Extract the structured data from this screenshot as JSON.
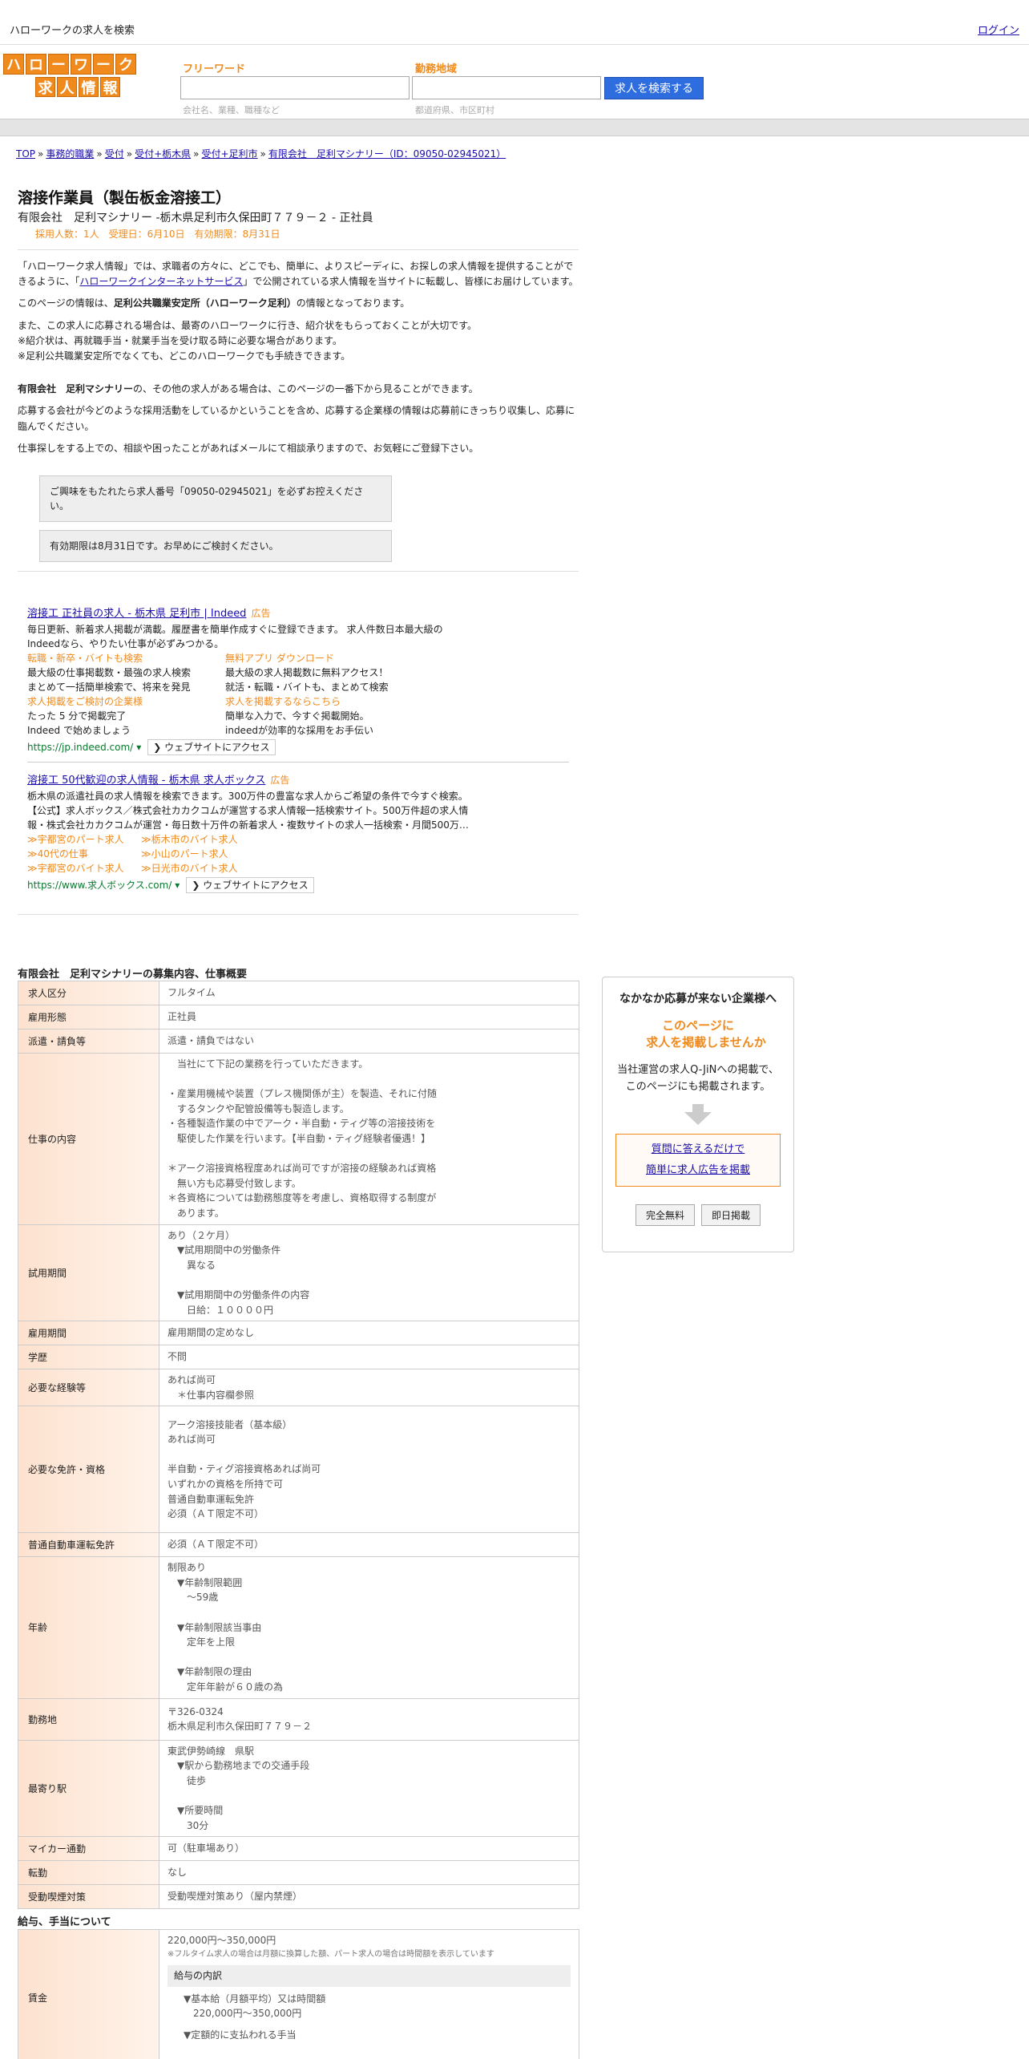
{
  "topbar": {
    "site_title": "ハローワークの求人を検索",
    "login": "ログイン"
  },
  "logo": {
    "row1": [
      "ハ",
      "ロ",
      "ー",
      "ワ",
      "ー",
      "ク"
    ],
    "row2": [
      "求",
      "人",
      "情",
      "報"
    ]
  },
  "search": {
    "freeword_label": "フリーワード",
    "freeword_hint": "会社名、業種、職種など",
    "area_label": "勤務地域",
    "area_hint": "都道府県、市区町村",
    "button": "求人を検索する"
  },
  "breadcrumb": [
    "TOP",
    "事務的職業",
    "受付",
    "受付+栃木県",
    "受付+足利市",
    "有限会社　足利マシナリー（ID：09050-02945021）"
  ],
  "job": {
    "title": "溶接作業員（製缶板金溶接工）",
    "company_line": "有限会社　足利マシナリー -栃木県足利市久保田町７７９－２ - 正社員",
    "meta": "採用人数：1人　受理日：6月10日　有効期限：8月31日"
  },
  "intro": {
    "p1_a": "「ハローワーク求人情報」では、求職者の方々に、どこでも、簡単に、よりスピーディに、お探しの求人情報を提供することができるように、「",
    "p1_link": "ハローワークインターネットサービス",
    "p1_b": "」で公開されている求人情報を当サイトに転載し、皆様にお届けしています。",
    "p2_a": "このページの情報は、",
    "p2_b": "足利公共職業安定所（ハローワーク足利）",
    "p2_c": "の情報となっております。",
    "p3_1": "また、この求人に応募される場合は、最寄のハローワークに行き、紹介状をもらっておくことが大切です。",
    "p3_2": "※紹介状は、再就職手当・就業手当を受け取る時に必要な場合があります。",
    "p3_3": "※足利公共職業安定所でなくても、どこのハローワークでも手続きできます。",
    "p4_a": "有限会社　足利マシナリー",
    "p4_b": "の、その他の求人がある場合は、このページの一番下から見ることができます。",
    "p5": "応募する会社が今どのような採用活動をしているかということを含め、応募する企業様の情報は応募前にきっちり収集し、応募に臨んでください。",
    "p6": "仕事探しをする上での、相談や困ったことがあればメールにて相談承りますので、お気軽にご登録下さい。"
  },
  "notices": [
    "ご興味をもたれたら求人番号「09050-02945021」を必ずお控えください。",
    "有効期限は8月31日です。お早めにご検討ください。"
  ],
  "ad1": {
    "title": "溶接工 正社員の求人 - 栃木県 足利市 | Indeed",
    "tag": "広告",
    "desc1": "毎日更新、新着求人掲載が満載。履歴書を簡単作成すぐに登録できます。 求人件数日本最大級の",
    "desc2": "Indeedなら、やりたい仕事が必ずみつかる。",
    "sitelinks": [
      {
        "title": "転職・新卒・バイトも検索",
        "d1": "最大級の仕事掲載数・最強の求人検索",
        "d2": "まとめて一括簡単検索で、将来を発見"
      },
      {
        "title": "無料アプリ ダウンロード",
        "d1": "最大級の求人掲載数に無料アクセス！",
        "d2": "就活・転職・バイトも、まとめて検索"
      },
      {
        "title": "求人掲載をご検討の企業様",
        "d1": "たった 5 分で掲載完了",
        "d2": "Indeed で始めましょう"
      },
      {
        "title": "求人を掲載するならこちら",
        "d1": "簡単な入力で、今すぐ掲載開始。",
        "d2": "indeedが効率的な採用をお手伝い"
      }
    ],
    "url": "https://jp.indeed.com/",
    "visit": "ウェブサイトにアクセス"
  },
  "ad2": {
    "title": "溶接工 50代歓迎の求人情報 - 栃木県 求人ボックス",
    "tag": "広告",
    "desc1": "栃木県の派遣社員の求人情報を検索できます。300万件の豊富な求人からご希望の条件で今すぐ検索。",
    "desc2": "【公式】求人ボックス／株式会社カカクコムが運営する求人情報一括検索サイト。500万件超の求人情",
    "desc3": "報・株式会社カカクコムが運営・毎日数十万件の新着求人・複数サイトの求人一括検索・月間500万…",
    "links": [
      "≫宇都宮のパート求人",
      "≫栃木市のバイト求人",
      "≫40代の仕事",
      "≫小山のパート求人",
      "≫宇都宮のバイト求人",
      "≫日光市のバイト求人"
    ],
    "url": "https://www.求人ボックス.com/",
    "visit": "ウェブサイトにアクセス"
  },
  "details": {
    "section_title": "有限会社　足利マシナリーの募集内容、仕事概要",
    "rows": [
      {
        "label": "求人区分",
        "value": "フルタイム"
      },
      {
        "label": "雇用形態",
        "value": "正社員"
      },
      {
        "label": "派遣・請負等",
        "value": "派遣・請負ではない"
      },
      {
        "label": "仕事の内容",
        "value": "　当社にて下記の業務を行っていただきます。\n\n・産業用機械や装置（プレス機関係が主）を製造、それに付随\n　するタンクや配管設備等も製造します。\n・各種製造作業の中でアーク・半自動・ティグ等の溶接技術を\n　駆使した作業を行います。【半自動・ティグ経験者優遇！】\n\n＊アーク溶接資格程度あれば尚可ですが溶接の経験あれば資格\n　無い方も応募受付致します。\n＊各資格については勤務態度等を考慮し、資格取得する制度が\n　あります。"
      },
      {
        "label": "試用期間",
        "value": "あり（２ケ月）\n　▼試用期間中の労働条件\n　　異なる\n\n　▼試用期間中の労働条件の内容\n　　日給：１００００円"
      },
      {
        "label": "雇用期間",
        "value": "雇用期間の定めなし"
      },
      {
        "label": "学歴",
        "value": "不問"
      },
      {
        "label": "必要な経験等",
        "value": "あれば尚可\n　＊仕事内容欄参照"
      },
      {
        "label": "必要な免許・資格",
        "value": "アーク溶接技能者（基本級）\nあれば尚可\n\n半自動・ティグ溶接資格あれば尚可\nいずれかの資格を所持で可\n普通自動車運転免許\n必須（ＡＴ限定不可）"
      },
      {
        "label": "普通自動車運転免許",
        "value": "必須（ＡＴ限定不可）"
      },
      {
        "label": "年齢",
        "value": "制限あり\n　▼年齢制限範囲\n　　〜59歳\n\n　▼年齢制限該当事由\n　　定年を上限\n\n　▼年齢制限の理由\n　　定年年齢が６０歳の為"
      },
      {
        "label": "勤務地",
        "value": "〒326-0324\n栃木県足利市久保田町７７９－２"
      },
      {
        "label": "最寄り駅",
        "value": "東武伊勢崎線　県駅\n　▼駅から勤務地までの交通手段\n　　徒歩\n\n　▼所要時間\n　　30分"
      },
      {
        "label": "マイカー通勤",
        "value": "可（駐車場あり）"
      },
      {
        "label": "転勤",
        "value": "なし"
      },
      {
        "label": "受動喫煙対策",
        "value": "受動喫煙対策あり（屋内禁煙）"
      }
    ]
  },
  "side": {
    "title": "なかなか応募が来ない企業様へ",
    "catch1": "このページに",
    "catch2": "求人を掲載しませんか",
    "desc1": "当社運営の求人Q-JiNへの掲載で、",
    "desc2": "このページにも掲載されます。",
    "link1": "質問に答えるだけで",
    "link2": "簡単に求人広告を掲載",
    "btn1": "完全無料",
    "btn2": "即日掲載"
  },
  "pay": {
    "section_title": "給与、手当について",
    "label": "賃金",
    "range": "220,000円〜350,000円",
    "note": "※フルタイム求人の場合は月額に換算した額、パート求人の場合は時間額を表示しています",
    "sub_title": "給与の内訳",
    "base_label": "▼基本給（月額平均）又は時間額",
    "base_value": "220,000円〜350,000円",
    "fixed_label": "▼定額的に支払われる手当"
  }
}
